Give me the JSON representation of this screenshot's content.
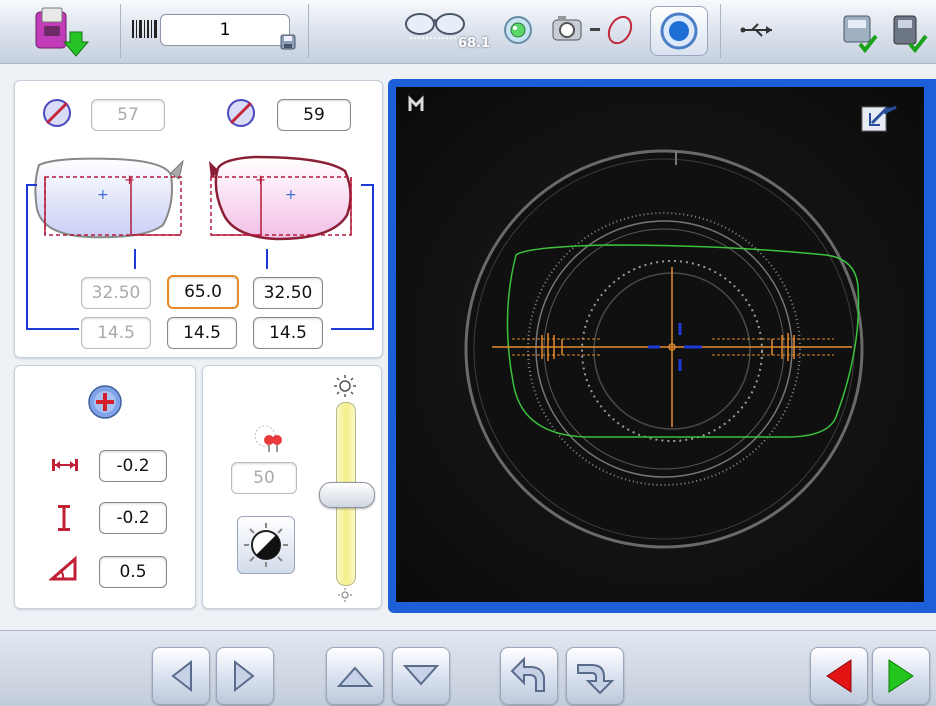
{
  "topbar": {
    "job_number": "1",
    "frame_size_readout": "68.1"
  },
  "lens_panel": {
    "left_diameter": "57",
    "right_diameter": "59",
    "left_half_pd": "32.50",
    "total_pd": "65.0",
    "right_half_pd": "32.50",
    "left_height": "14.5",
    "center_height": "14.5",
    "right_height": "14.5"
  },
  "adjust_panel": {
    "horizontal_offset": "-0.2",
    "vertical_offset": "-0.2",
    "axis_offset": "0.5"
  },
  "light_panel": {
    "illumination_value": "50",
    "brightness_level": 0.5
  },
  "colors": {
    "accent_blue": "#1d5fd6",
    "centering_orange": "#e58a2b",
    "outline_green": "#3cc23c",
    "nav_red": "#e21414",
    "nav_green": "#23c61c"
  }
}
